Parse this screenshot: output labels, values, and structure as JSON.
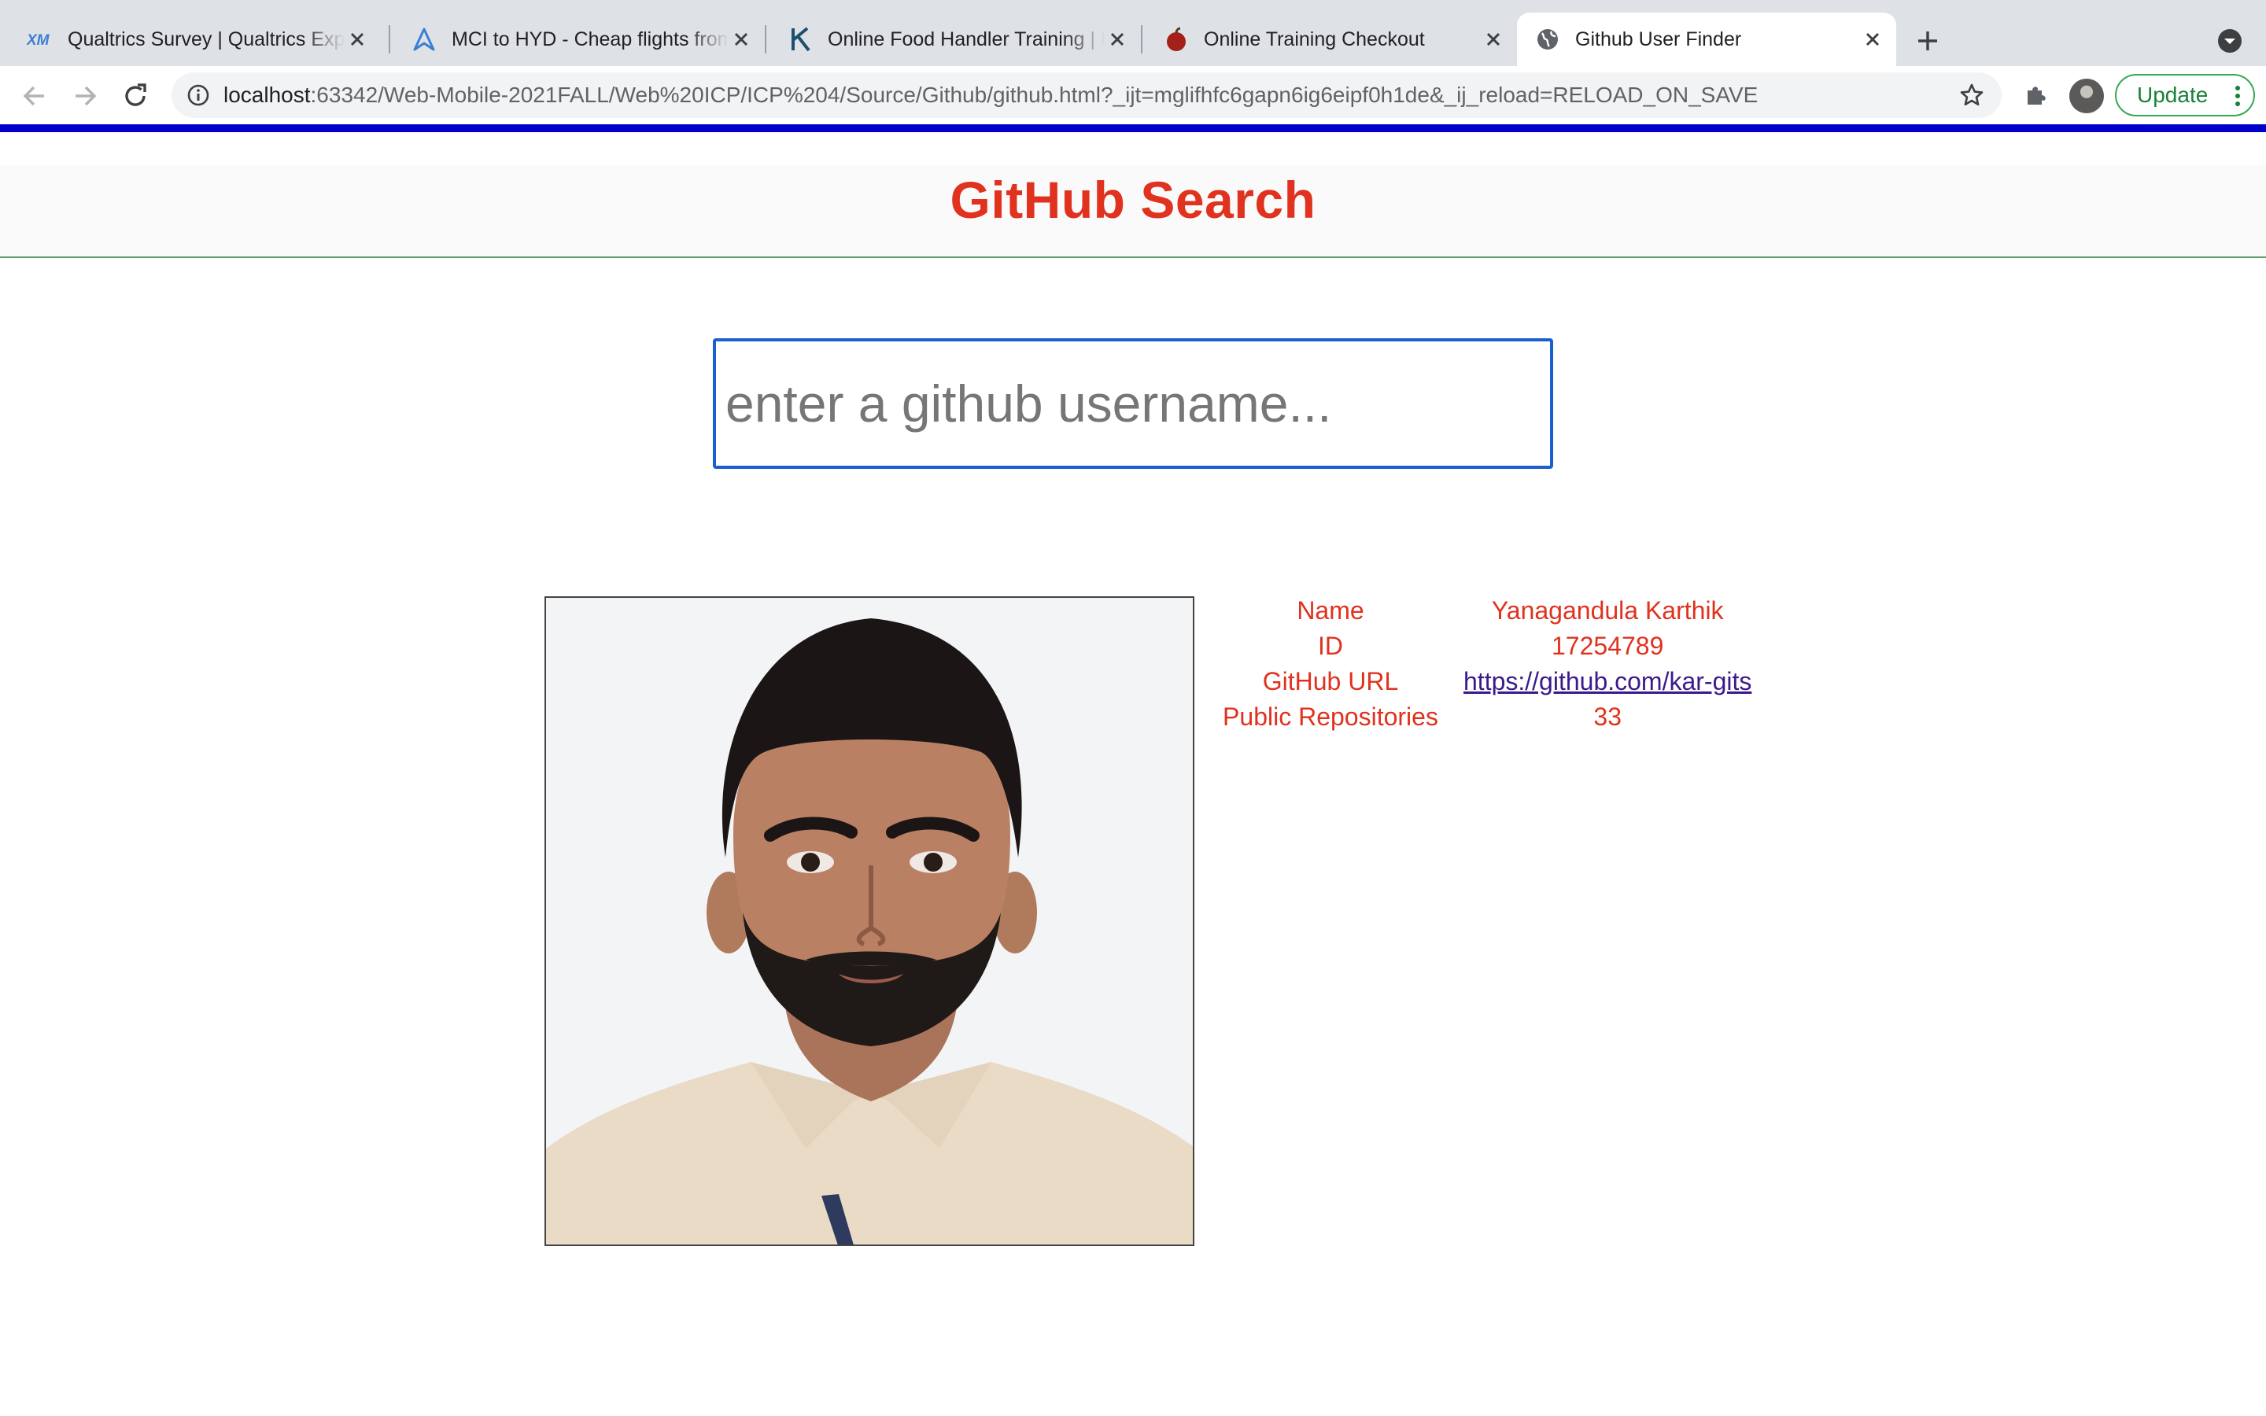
{
  "browser": {
    "tabs": [
      {
        "title": "Qualtrics Survey | Qualtrics Experience Management",
        "icon": "qualtrics-xm-icon"
      },
      {
        "title": "MCI to HYD - Cheap flights from Kansas City",
        "icon": "flight-deals-icon"
      },
      {
        "title": "Online Food Handler Training | Food Safety",
        "icon": "k-logo-icon"
      },
      {
        "title": "Online Training Checkout",
        "icon": "apple-icon"
      },
      {
        "title": "Github User Finder",
        "icon": "globe-icon",
        "active": true
      }
    ],
    "address": {
      "host": "localhost",
      "path": ":63342/Web-Mobile-2021FALL/Web%20ICP/ICP%204/Source/Github/github.html?_ijt=mglifhfc6gapn6ig6eipf0h1de&_ij_reload=RELOAD_ON_SAVE"
    },
    "update_label": "Update"
  },
  "page": {
    "title": "GitHub Search",
    "search": {
      "placeholder": "enter a github username...",
      "value": ""
    },
    "photo_alt": "GitHub avatar",
    "user": {
      "rows": [
        {
          "label": "Name",
          "value": "Yanagandula Karthik"
        },
        {
          "label": "ID",
          "value": "17254789"
        },
        {
          "label": "GitHub URL",
          "value": "https://github.com/kar-gits"
        },
        {
          "label": "Public Repositories",
          "value": "33"
        }
      ]
    }
  },
  "colors": {
    "accent_red": "#e0321e",
    "stripe_blue": "#0000cc",
    "header_border": "#5e9a6a",
    "input_border": "#1a5fd0",
    "link": "#3c1a8c"
  }
}
